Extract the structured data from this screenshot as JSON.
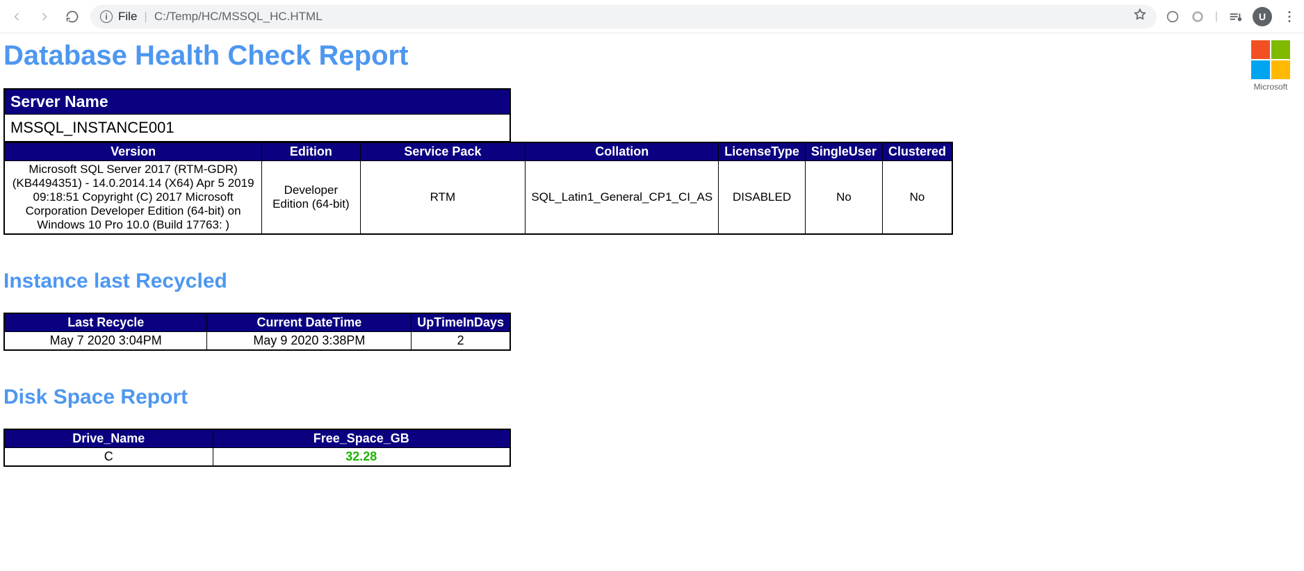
{
  "browser": {
    "file_label": "File",
    "url_path": "C:/Temp/HC/MSSQL_HC.HTML",
    "avatar_letter": "U"
  },
  "logo_label": "Microsoft",
  "title": "Database Health Check Report",
  "server_name_header": "Server Name",
  "server_name_value": "MSSQL_INSTANCE001",
  "details_headers": {
    "version": "Version",
    "edition": "Edition",
    "service_pack": "Service Pack",
    "collation": "Collation",
    "license_type": "LicenseType",
    "single_user": "SingleUser",
    "clustered": "Clustered"
  },
  "details_row": {
    "version": "Microsoft SQL Server 2017 (RTM-GDR) (KB4494351) - 14.0.2014.14 (X64) Apr 5 2019 09:18:51 Copyright (C) 2017 Microsoft Corporation Developer Edition (64-bit) on Windows 10 Pro 10.0 (Build 17763: )",
    "edition": "Developer Edition (64-bit)",
    "service_pack": "RTM",
    "collation": "SQL_Latin1_General_CP1_CI_AS",
    "license_type": "DISABLED",
    "single_user": "No",
    "clustered": "No"
  },
  "recycle_section_title": "Instance last Recycled",
  "recycle_headers": {
    "last_recycle": "Last Recycle",
    "current_datetime": "Current DateTime",
    "uptime": "UpTimeInDays"
  },
  "recycle_row": {
    "last_recycle": "May 7 2020 3:04PM",
    "current_datetime": "May 9 2020 3:38PM",
    "uptime": "2"
  },
  "disk_section_title": "Disk Space Report",
  "disk_headers": {
    "drive": "Drive_Name",
    "free": "Free_Space_GB"
  },
  "disk_row": {
    "drive": "C",
    "free": "32.28"
  }
}
